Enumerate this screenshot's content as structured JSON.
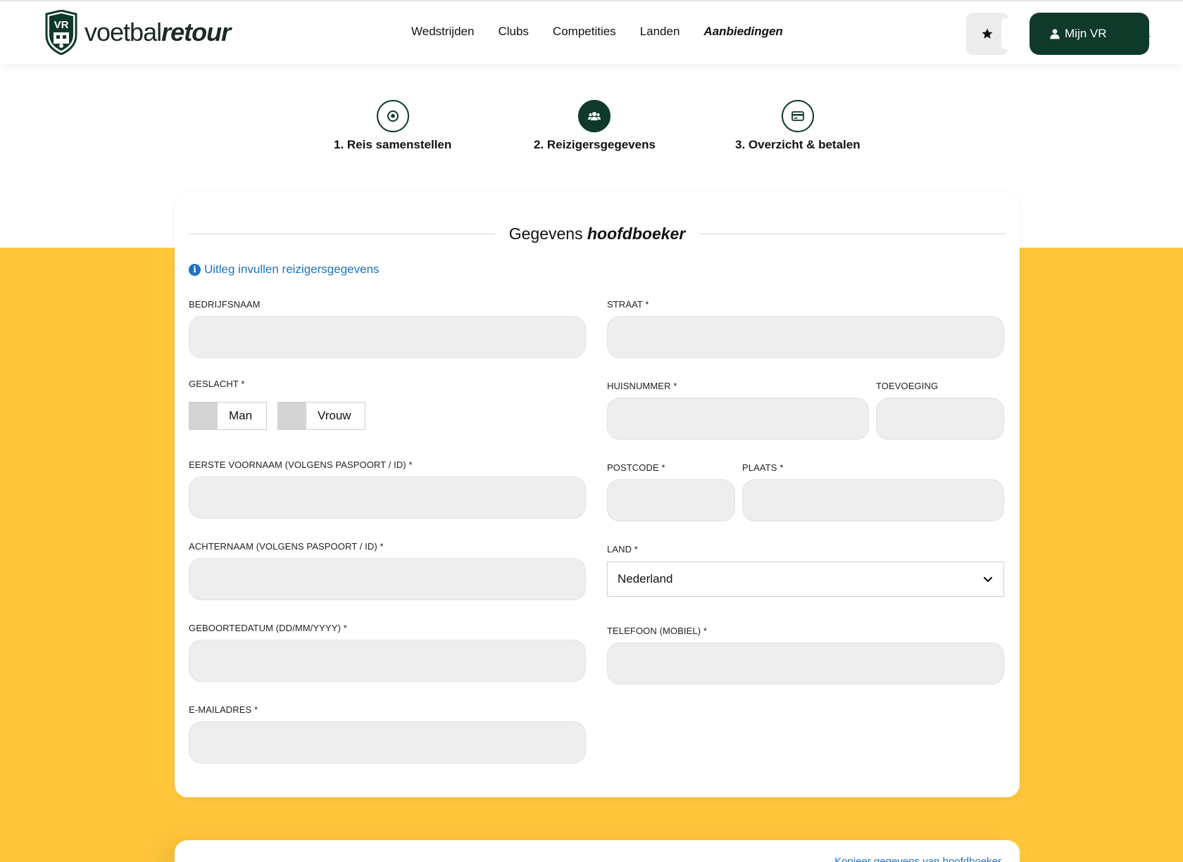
{
  "brand": {
    "text_light": "voetbal",
    "text_bold": "retour",
    "badge": "VR"
  },
  "nav": [
    {
      "label": "Wedstrijden"
    },
    {
      "label": "Clubs"
    },
    {
      "label": "Competities"
    },
    {
      "label": "Landen"
    },
    {
      "label": "Aanbiedingen"
    }
  ],
  "account": {
    "label": "Mijn VR"
  },
  "steps": [
    {
      "label": "1. Reis samenstellen",
      "icon": "soccer-ball-icon",
      "active": false
    },
    {
      "label": "2. Reizigersgegevens",
      "icon": "users-icon",
      "active": true
    },
    {
      "label": "3. Overzicht & betalen",
      "icon": "credit-card-icon",
      "active": false
    }
  ],
  "form": {
    "title_regular": "Gegevens",
    "title_bold": "hoofdboeker",
    "info_link": "Uitleg invullen reizigersgegevens",
    "labels": {
      "company": "BEDRIJFSNAAM",
      "gender": "GESLACHT *",
      "first_name": "EERSTE VOORNAAM (VOLGENS PASPOORT / ID) *",
      "last_name": "ACHTERNAAM (VOLGENS PASPOORT / ID) *",
      "birthdate": "GEBOORTEDATUM (DD/MM/YYYY) *",
      "email": "E-MAILADRES *",
      "street": "STRAAT *",
      "house_number": "HUISNUMMER *",
      "addition": "TOEVOEGING",
      "postcode": "POSTCODE *",
      "city": "PLAATS *",
      "country": "LAND *",
      "phone": "TELEFOON (MOBIEL) *"
    },
    "gender_options": [
      "Man",
      "Vrouw"
    ],
    "country_value": "Nederland"
  },
  "second_card": {
    "copy_link": "Kopieer gegevens van hoofdboeker"
  },
  "colors": {
    "brand_green": "#0f3a2a",
    "accent_yellow": "#ffc63b",
    "link_blue": "#1e73be"
  }
}
